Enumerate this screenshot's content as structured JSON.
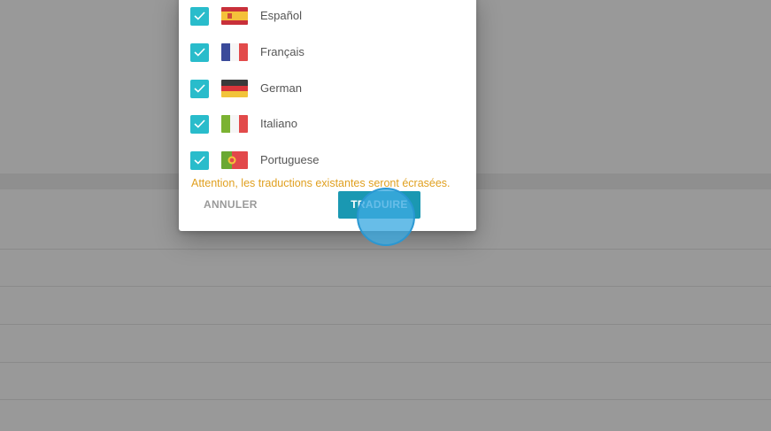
{
  "dialog": {
    "languages": [
      {
        "label": "Español",
        "checked": true,
        "flag": "spain-flag"
      },
      {
        "label": "Français",
        "checked": true,
        "flag": "france-flag"
      },
      {
        "label": "German",
        "checked": true,
        "flag": "germany-flag"
      },
      {
        "label": "Italiano",
        "checked": true,
        "flag": "italy-flag"
      },
      {
        "label": "Portuguese",
        "checked": true,
        "flag": "portugal-flag"
      }
    ],
    "warning": "Attention, les traductions existantes seront écrasées.",
    "cancel_label": "ANNULER",
    "translate_label": "TRADUIRE"
  },
  "colors": {
    "checkbox": "#29bccb",
    "warning": "#e0a020",
    "primary_button": "#1a98b2",
    "overlay": "rgba(0,0,0,0.40)"
  }
}
